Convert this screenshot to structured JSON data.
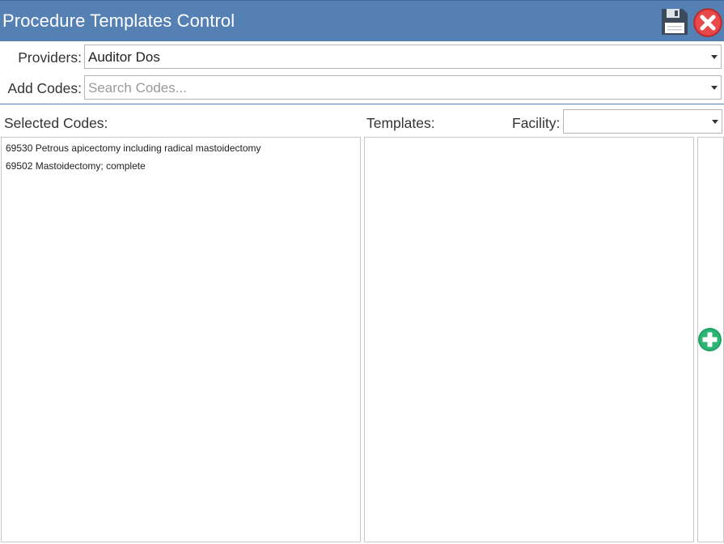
{
  "window": {
    "title": "Procedure Templates Control",
    "save_icon": "floppy-disk-icon",
    "close_icon": "red-x-circle-icon"
  },
  "providers": {
    "label": "Providers:",
    "value": "Auditor Dos"
  },
  "add_codes": {
    "label": "Add Codes:",
    "placeholder": "Search Codes..."
  },
  "selected_codes": {
    "label": "Selected Codes:",
    "items": [
      "69530 Petrous apicectomy including radical mastoidectomy",
      "69502 Mastoidectomy; complete"
    ]
  },
  "templates": {
    "label": "Templates:",
    "items": []
  },
  "facility": {
    "label": "Facility:",
    "value": ""
  },
  "add_template": {
    "icon": "green-plus-circle-icon"
  },
  "colors": {
    "titlebar": "#5580b4",
    "close": "#e0393a",
    "add": "#21a366"
  }
}
